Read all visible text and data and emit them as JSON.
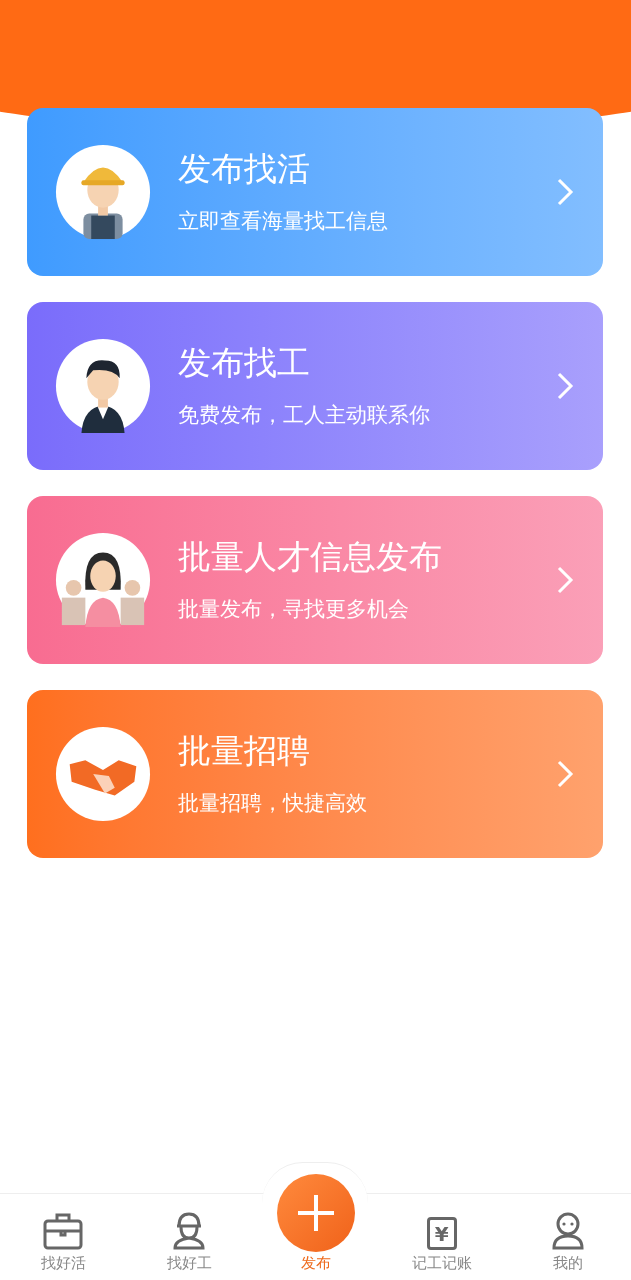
{
  "cards": [
    {
      "kind": "worker",
      "title": "发布找活",
      "subtitle": "立即查看海量找工信息",
      "color": "#3f9bff"
    },
    {
      "kind": "boss",
      "title": "发布找工",
      "subtitle": "免费发布，工人主动联系你",
      "color": "#7a6cfb"
    },
    {
      "kind": "team",
      "title": "批量人才信息发布",
      "subtitle": "批量发布，寻找更多机会",
      "color": "#f86c91"
    },
    {
      "kind": "handshake",
      "title": "批量招聘",
      "subtitle": "批量招聘，快捷高效",
      "color": "#ff6f1e"
    }
  ],
  "nav": [
    {
      "kind": "briefcase",
      "label": "找好活",
      "selected": false
    },
    {
      "kind": "worker",
      "label": "找好工",
      "selected": false
    },
    {
      "kind": "publish",
      "label": "发布",
      "selected": true
    },
    {
      "kind": "ledger",
      "label": "记工记账",
      "selected": false,
      "glyph": "¥"
    },
    {
      "kind": "person",
      "label": "我的",
      "selected": false
    }
  ]
}
